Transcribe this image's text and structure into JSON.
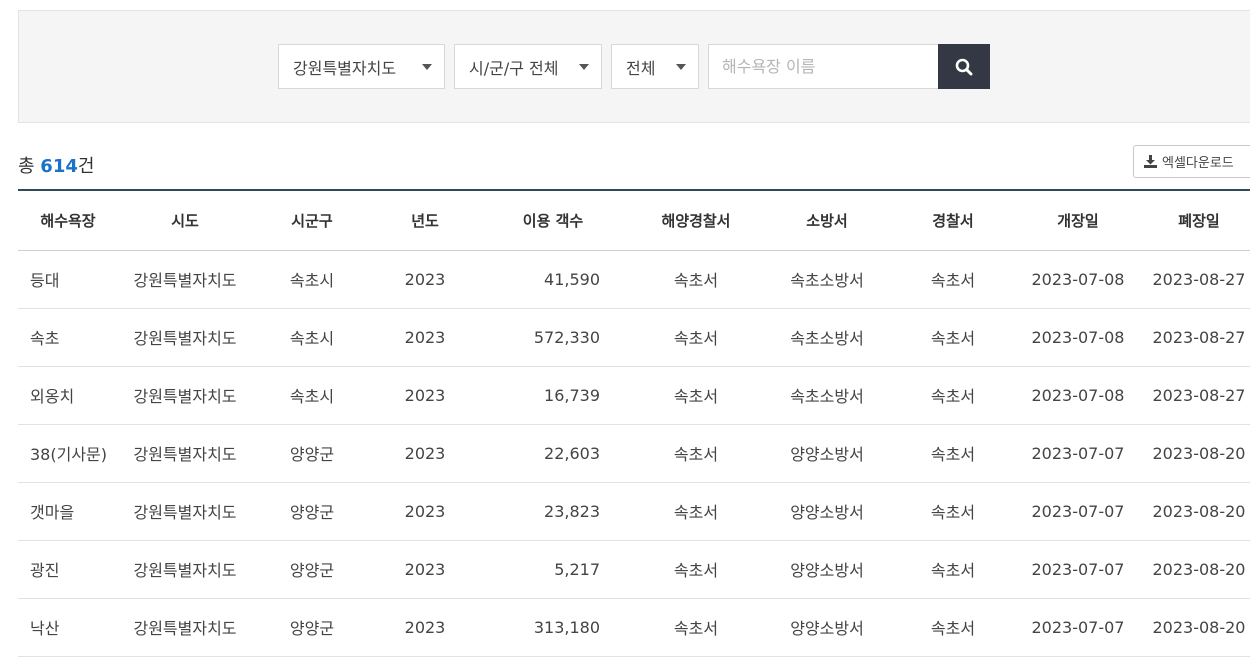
{
  "filters": {
    "province": "강원특별자치도",
    "district": "시/군/구 전체",
    "type": "전체",
    "search_placeholder": "해수욕장 이름"
  },
  "summary": {
    "prefix": "총 ",
    "count": "614",
    "suffix": "건"
  },
  "excel_button": {
    "label": "엑셀다운로드"
  },
  "table": {
    "columns": [
      "해수욕장",
      "시도",
      "시군구",
      "년도",
      "이용 객수",
      "해양경찰서",
      "소방서",
      "경찰서",
      "개장일",
      "폐장일"
    ],
    "rows": [
      [
        "등대",
        "강원특별자치도",
        "속초시",
        "2023",
        "41,590",
        "속초서",
        "속초소방서",
        "속초서",
        "2023-07-08",
        "2023-08-27"
      ],
      [
        "속초",
        "강원특별자치도",
        "속초시",
        "2023",
        "572,330",
        "속초서",
        "속초소방서",
        "속초서",
        "2023-07-08",
        "2023-08-27"
      ],
      [
        "외옹치",
        "강원특별자치도",
        "속초시",
        "2023",
        "16,739",
        "속초서",
        "속초소방서",
        "속초서",
        "2023-07-08",
        "2023-08-27"
      ],
      [
        "38(기사문)",
        "강원특별자치도",
        "양양군",
        "2023",
        "22,603",
        "속초서",
        "양양소방서",
        "속초서",
        "2023-07-07",
        "2023-08-20"
      ],
      [
        "갯마을",
        "강원특별자치도",
        "양양군",
        "2023",
        "23,823",
        "속초서",
        "양양소방서",
        "속초서",
        "2023-07-07",
        "2023-08-20"
      ],
      [
        "광진",
        "강원특별자치도",
        "양양군",
        "2023",
        "5,217",
        "속초서",
        "양양소방서",
        "속초서",
        "2023-07-07",
        "2023-08-20"
      ],
      [
        "낙산",
        "강원특별자치도",
        "양양군",
        "2023",
        "313,180",
        "속초서",
        "양양소방서",
        "속초서",
        "2023-07-07",
        "2023-08-20"
      ]
    ]
  }
}
